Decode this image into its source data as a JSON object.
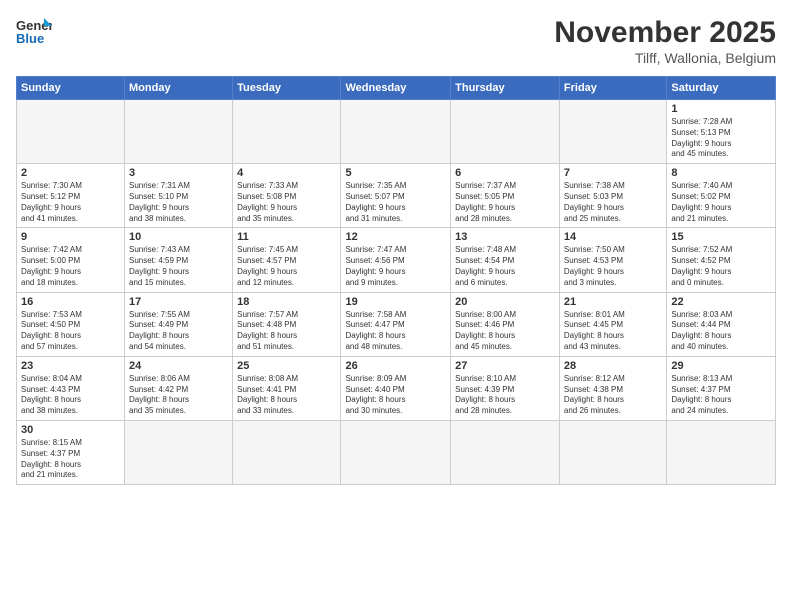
{
  "header": {
    "logo_general": "General",
    "logo_blue": "Blue",
    "month_title": "November 2025",
    "location": "Tilff, Wallonia, Belgium"
  },
  "days_of_week": [
    "Sunday",
    "Monday",
    "Tuesday",
    "Wednesday",
    "Thursday",
    "Friday",
    "Saturday"
  ],
  "weeks": [
    [
      {
        "day": "",
        "info": ""
      },
      {
        "day": "",
        "info": ""
      },
      {
        "day": "",
        "info": ""
      },
      {
        "day": "",
        "info": ""
      },
      {
        "day": "",
        "info": ""
      },
      {
        "day": "",
        "info": ""
      },
      {
        "day": "1",
        "info": "Sunrise: 7:28 AM\nSunset: 5:13 PM\nDaylight: 9 hours\nand 45 minutes."
      }
    ],
    [
      {
        "day": "2",
        "info": "Sunrise: 7:30 AM\nSunset: 5:12 PM\nDaylight: 9 hours\nand 41 minutes."
      },
      {
        "day": "3",
        "info": "Sunrise: 7:31 AM\nSunset: 5:10 PM\nDaylight: 9 hours\nand 38 minutes."
      },
      {
        "day": "4",
        "info": "Sunrise: 7:33 AM\nSunset: 5:08 PM\nDaylight: 9 hours\nand 35 minutes."
      },
      {
        "day": "5",
        "info": "Sunrise: 7:35 AM\nSunset: 5:07 PM\nDaylight: 9 hours\nand 31 minutes."
      },
      {
        "day": "6",
        "info": "Sunrise: 7:37 AM\nSunset: 5:05 PM\nDaylight: 9 hours\nand 28 minutes."
      },
      {
        "day": "7",
        "info": "Sunrise: 7:38 AM\nSunset: 5:03 PM\nDaylight: 9 hours\nand 25 minutes."
      },
      {
        "day": "8",
        "info": "Sunrise: 7:40 AM\nSunset: 5:02 PM\nDaylight: 9 hours\nand 21 minutes."
      }
    ],
    [
      {
        "day": "9",
        "info": "Sunrise: 7:42 AM\nSunset: 5:00 PM\nDaylight: 9 hours\nand 18 minutes."
      },
      {
        "day": "10",
        "info": "Sunrise: 7:43 AM\nSunset: 4:59 PM\nDaylight: 9 hours\nand 15 minutes."
      },
      {
        "day": "11",
        "info": "Sunrise: 7:45 AM\nSunset: 4:57 PM\nDaylight: 9 hours\nand 12 minutes."
      },
      {
        "day": "12",
        "info": "Sunrise: 7:47 AM\nSunset: 4:56 PM\nDaylight: 9 hours\nand 9 minutes."
      },
      {
        "day": "13",
        "info": "Sunrise: 7:48 AM\nSunset: 4:54 PM\nDaylight: 9 hours\nand 6 minutes."
      },
      {
        "day": "14",
        "info": "Sunrise: 7:50 AM\nSunset: 4:53 PM\nDaylight: 9 hours\nand 3 minutes."
      },
      {
        "day": "15",
        "info": "Sunrise: 7:52 AM\nSunset: 4:52 PM\nDaylight: 9 hours\nand 0 minutes."
      }
    ],
    [
      {
        "day": "16",
        "info": "Sunrise: 7:53 AM\nSunset: 4:50 PM\nDaylight: 8 hours\nand 57 minutes."
      },
      {
        "day": "17",
        "info": "Sunrise: 7:55 AM\nSunset: 4:49 PM\nDaylight: 8 hours\nand 54 minutes."
      },
      {
        "day": "18",
        "info": "Sunrise: 7:57 AM\nSunset: 4:48 PM\nDaylight: 8 hours\nand 51 minutes."
      },
      {
        "day": "19",
        "info": "Sunrise: 7:58 AM\nSunset: 4:47 PM\nDaylight: 8 hours\nand 48 minutes."
      },
      {
        "day": "20",
        "info": "Sunrise: 8:00 AM\nSunset: 4:46 PM\nDaylight: 8 hours\nand 45 minutes."
      },
      {
        "day": "21",
        "info": "Sunrise: 8:01 AM\nSunset: 4:45 PM\nDaylight: 8 hours\nand 43 minutes."
      },
      {
        "day": "22",
        "info": "Sunrise: 8:03 AM\nSunset: 4:44 PM\nDaylight: 8 hours\nand 40 minutes."
      }
    ],
    [
      {
        "day": "23",
        "info": "Sunrise: 8:04 AM\nSunset: 4:43 PM\nDaylight: 8 hours\nand 38 minutes."
      },
      {
        "day": "24",
        "info": "Sunrise: 8:06 AM\nSunset: 4:42 PM\nDaylight: 8 hours\nand 35 minutes."
      },
      {
        "day": "25",
        "info": "Sunrise: 8:08 AM\nSunset: 4:41 PM\nDaylight: 8 hours\nand 33 minutes."
      },
      {
        "day": "26",
        "info": "Sunrise: 8:09 AM\nSunset: 4:40 PM\nDaylight: 8 hours\nand 30 minutes."
      },
      {
        "day": "27",
        "info": "Sunrise: 8:10 AM\nSunset: 4:39 PM\nDaylight: 8 hours\nand 28 minutes."
      },
      {
        "day": "28",
        "info": "Sunrise: 8:12 AM\nSunset: 4:38 PM\nDaylight: 8 hours\nand 26 minutes."
      },
      {
        "day": "29",
        "info": "Sunrise: 8:13 AM\nSunset: 4:37 PM\nDaylight: 8 hours\nand 24 minutes."
      }
    ],
    [
      {
        "day": "30",
        "info": "Sunrise: 8:15 AM\nSunset: 4:37 PM\nDaylight: 8 hours\nand 21 minutes."
      },
      {
        "day": "",
        "info": ""
      },
      {
        "day": "",
        "info": ""
      },
      {
        "day": "",
        "info": ""
      },
      {
        "day": "",
        "info": ""
      },
      {
        "day": "",
        "info": ""
      },
      {
        "day": "",
        "info": ""
      }
    ]
  ]
}
